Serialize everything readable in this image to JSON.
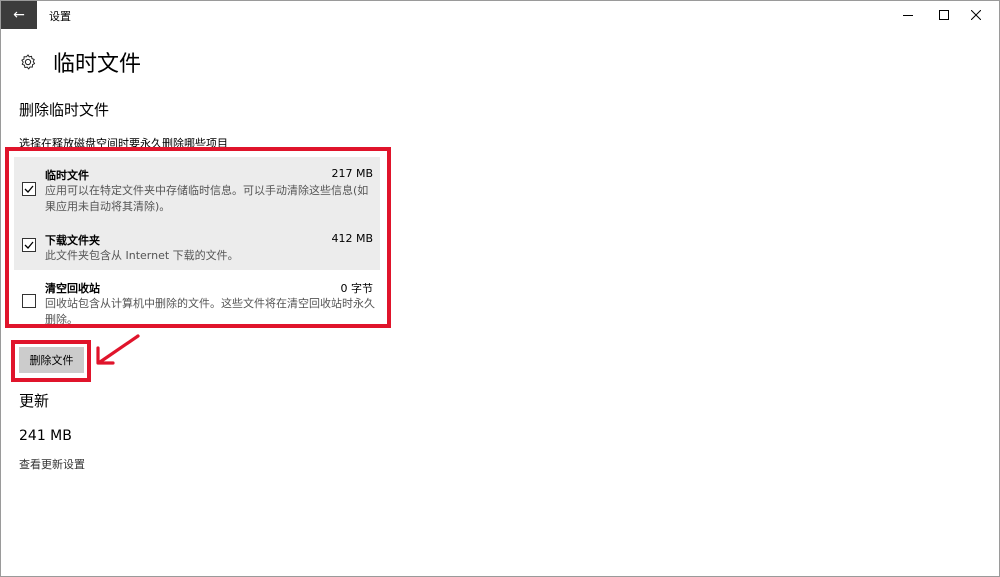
{
  "window": {
    "title": "设置",
    "back_icon": "←"
  },
  "page": {
    "title": "临时文件"
  },
  "delete_section": {
    "title": "删除临时文件",
    "description": "选择在释放磁盘空间时要永久删除哪些项目",
    "items": [
      {
        "name": "临时文件",
        "size": "217 MB",
        "description": "应用可以在特定文件夹中存储临时信息。可以手动清除这些信息(如果应用未自动将其清除)。",
        "checked": true
      },
      {
        "name": "下载文件夹",
        "size": "412 MB",
        "description": "此文件夹包含从 Internet 下载的文件。",
        "checked": true
      },
      {
        "name": "清空回收站",
        "size": "0 字节",
        "description": "回收站包含从计算机中删除的文件。这些文件将在清空回收站时永久删除。",
        "checked": false
      }
    ],
    "delete_button_label": "删除文件"
  },
  "update_section": {
    "title": "更新",
    "size": "241 MB",
    "link_label": "查看更新设置"
  },
  "colors": {
    "highlight": "#e0142b",
    "selected_row": "#ececec",
    "button_bg": "#cccccc",
    "titlebar_back": "#3c3c3c"
  }
}
